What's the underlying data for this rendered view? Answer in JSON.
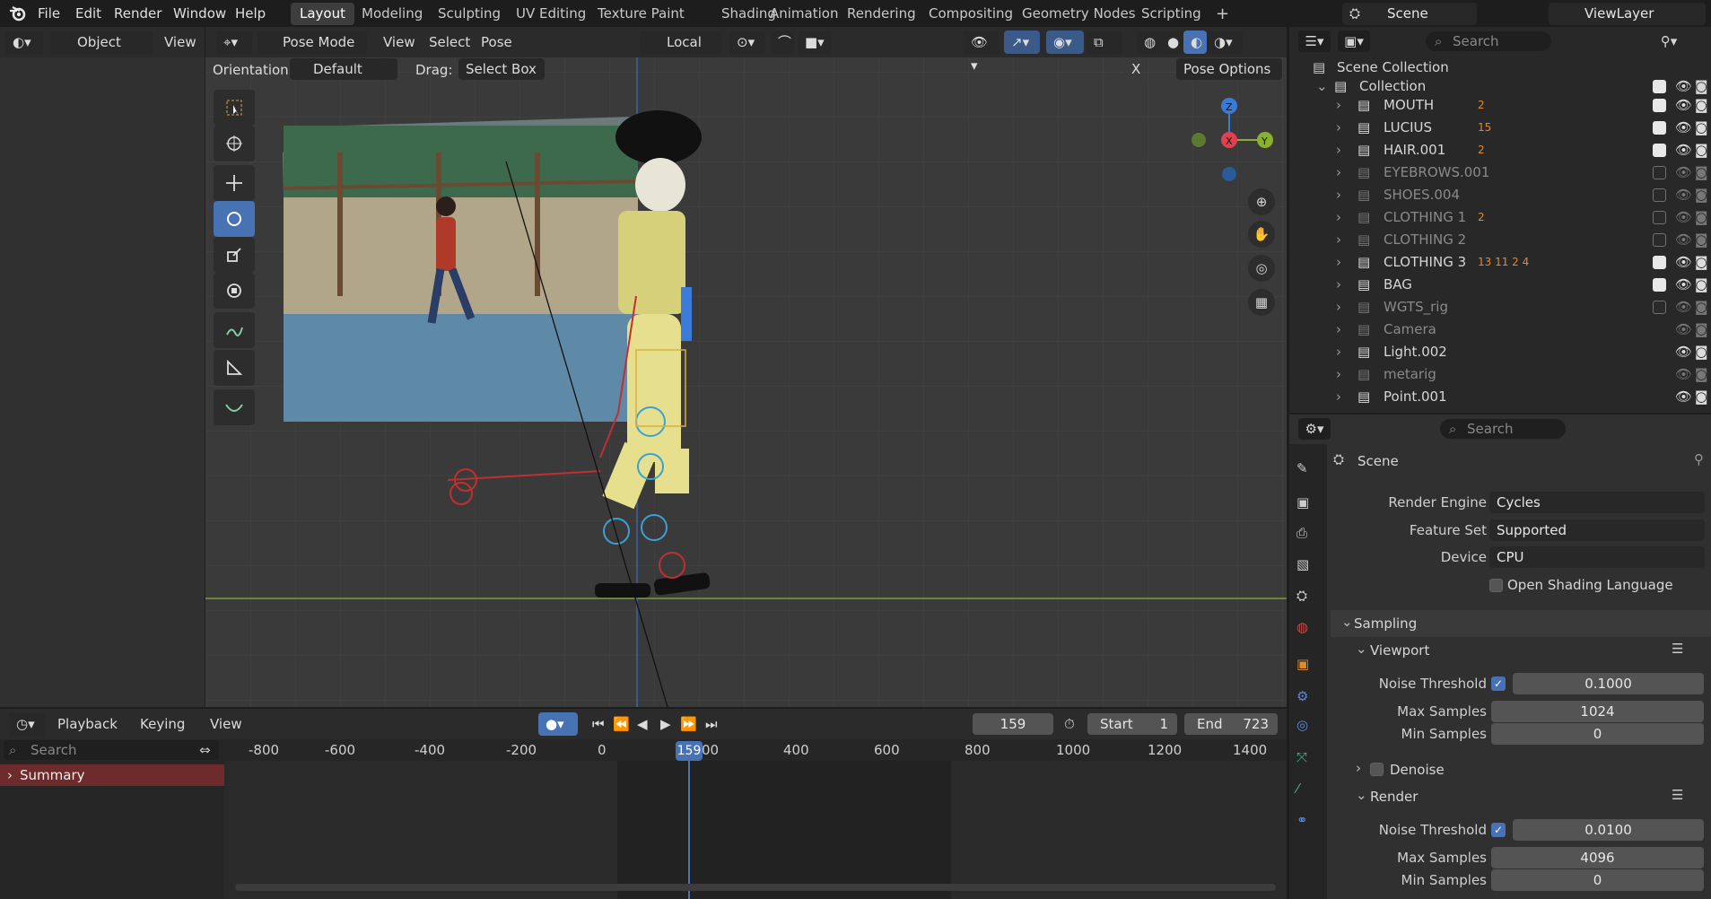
{
  "menu": {
    "items": [
      "File",
      "Edit",
      "Render",
      "Window",
      "Help"
    ],
    "workspaces": [
      "Layout",
      "Modeling",
      "Sculpting",
      "UV Editing",
      "Texture Paint",
      "Shading",
      "Animation",
      "Rendering",
      "Compositing",
      "Geometry Nodes",
      "Scripting"
    ],
    "active_workspace": "Layout",
    "add_tab": "+",
    "scene_label": "Scene",
    "viewlayer_label": "ViewLayer"
  },
  "left_header": {
    "mode": "Object",
    "view": "View"
  },
  "viewport_header": {
    "mode": "Pose Mode",
    "menus": [
      "View",
      "Select",
      "Pose"
    ],
    "transform_orientation": "Local",
    "orientation_label": "Orientation:",
    "orientation_value": "Default",
    "drag_label": "Drag:",
    "drag_value": "Select Box",
    "x_mirror": "X",
    "pose_options": "Pose Options"
  },
  "gizmo": {
    "z": "Z",
    "x": "X",
    "y": "Y"
  },
  "outliner": {
    "search_placeholder": "Search",
    "root": "Scene Collection",
    "collection": "Collection",
    "rows": [
      {
        "name": "MOUTH",
        "badge": "2",
        "on": true,
        "dim": false
      },
      {
        "name": "LUCIUS",
        "badge": "15",
        "on": true,
        "dim": false
      },
      {
        "name": "HAIR.001",
        "badge": "2",
        "on": true,
        "dim": false
      },
      {
        "name": "EYEBROWS.001",
        "badge": "",
        "on": false,
        "dim": true
      },
      {
        "name": "SHOES.004",
        "badge": "",
        "on": false,
        "dim": true
      },
      {
        "name": "CLOTHING 1",
        "badge": "2",
        "on": false,
        "dim": true
      },
      {
        "name": "CLOTHING 2",
        "badge": "",
        "on": false,
        "dim": true
      },
      {
        "name": "CLOTHING 3",
        "badge": "13 11 2 4",
        "on": true,
        "dim": false
      },
      {
        "name": "BAG",
        "badge": "",
        "on": true,
        "dim": false
      },
      {
        "name": "WGTS_rig",
        "badge": "",
        "on": false,
        "dim": true
      },
      {
        "name": "Camera",
        "badge": "",
        "on": null,
        "dim": true
      },
      {
        "name": "Light.002",
        "badge": "",
        "on": null,
        "dim": false
      },
      {
        "name": "metarig",
        "badge": "",
        "on": null,
        "dim": true
      },
      {
        "name": "Point.001",
        "badge": "",
        "on": null,
        "dim": false
      }
    ]
  },
  "properties": {
    "search_placeholder": "Search",
    "context": "Scene",
    "render_engine_label": "Render Engine",
    "render_engine": "Cycles",
    "feature_set_label": "Feature Set",
    "feature_set": "Supported",
    "device_label": "Device",
    "device": "CPU",
    "osl_label": "Open Shading Language",
    "sampling": "Sampling",
    "viewport": "Viewport",
    "noise_threshold_label": "Noise Threshold",
    "vp_noise_threshold": "0.1000",
    "max_samples_label": "Max Samples",
    "vp_max_samples": "1024",
    "min_samples_label": "Min Samples",
    "vp_min_samples": "0",
    "denoise": "Denoise",
    "render": "Render",
    "r_noise_threshold": "0.0100",
    "r_max_samples": "4096",
    "r_min_samples": "0"
  },
  "timeline": {
    "menus": [
      "Playback",
      "Keying",
      "View"
    ],
    "current_frame": "159",
    "start_label": "Start",
    "start": "1",
    "end_label": "End",
    "end": "723",
    "search_placeholder": "Search",
    "summary": "Summary",
    "ticks": [
      "-800",
      "-600",
      "-400",
      "-200",
      "0",
      "400",
      "600",
      "800",
      "1000",
      "1200",
      "1400"
    ],
    "playhead": "159",
    "playhead_trailing": "00"
  }
}
